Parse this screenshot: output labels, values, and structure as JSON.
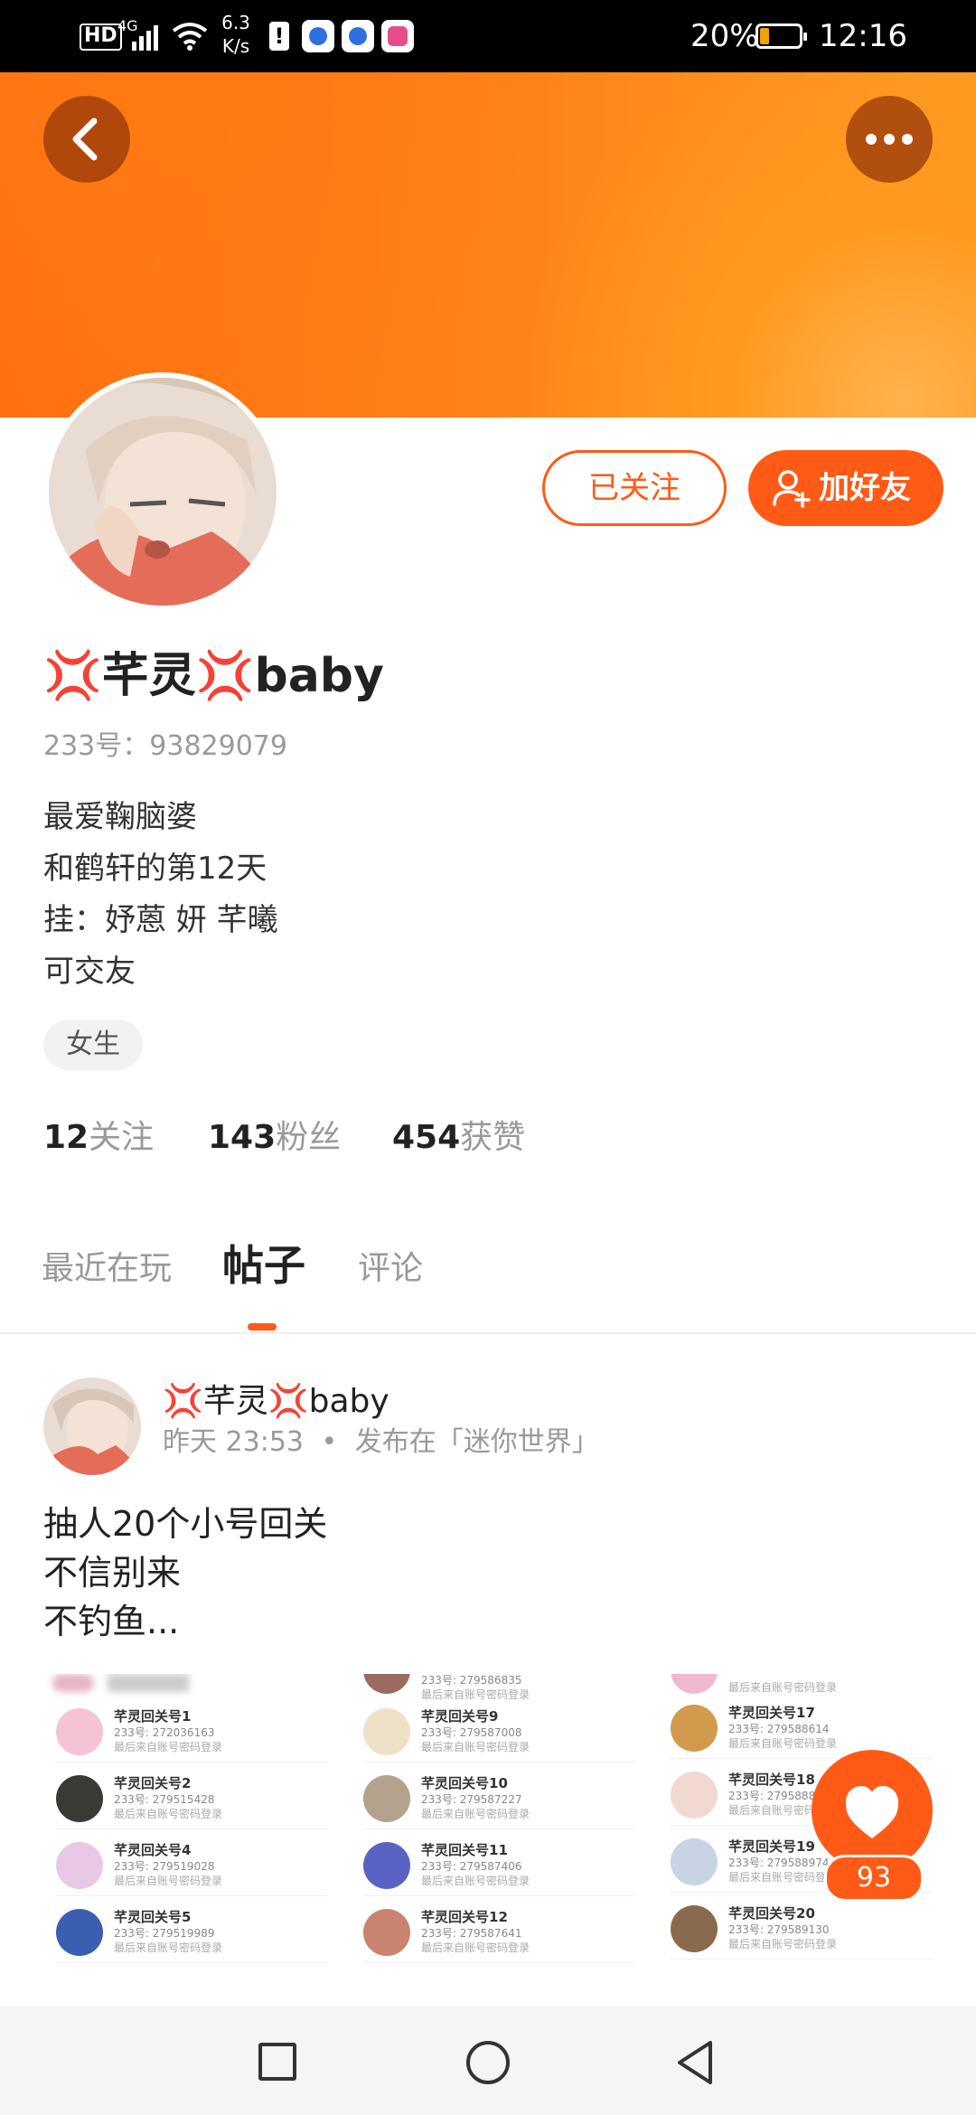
{
  "status_bar": {
    "hd": "HD",
    "network": "4G",
    "speed_value": "6.3",
    "speed_unit": "K/s",
    "battery": "20%",
    "time": "12:16"
  },
  "header": {
    "back_icon": "chevron-left-icon",
    "more_icon": "more-dots-icon"
  },
  "profile": {
    "name": "💢芊灵💢baby",
    "id_label": "233号：",
    "id_value": "93829079",
    "bio_lines": [
      "最爱鞠脑婆",
      "和鹤轩的第12天",
      "挂：妤蒽 妍 芊曦",
      "可交友"
    ],
    "gender_tag": "女生",
    "follow_button": "已关注",
    "add_friend_button": "加好友",
    "stats": [
      {
        "count": "12",
        "label": "关注"
      },
      {
        "count": "143",
        "label": "粉丝"
      },
      {
        "count": "454",
        "label": "获赞"
      }
    ]
  },
  "tabs": [
    {
      "label": "最近在玩",
      "active": false
    },
    {
      "label": "帖子",
      "active": true
    },
    {
      "label": "评论",
      "active": false
    }
  ],
  "post": {
    "author": "💢芊灵💢baby",
    "time": "昨天 23:53",
    "separator": "•",
    "posted_in": "发布在「迷你世界」",
    "lines": [
      "抽人20个小号回关",
      "不信别来",
      "不钓鱼..."
    ],
    "image_items": {
      "col1": [
        {
          "name": "芊灵回关号1",
          "id": "233号: 272036163",
          "note": "最后来自账号密码登录"
        },
        {
          "name": "芊灵回关号2",
          "id": "233号: 279515428",
          "note": "最后来自账号密码登录"
        },
        {
          "name": "芊灵回关号4",
          "id": "233号: 279519028",
          "note": "最后来自账号密码登录"
        },
        {
          "name": "芊灵回关号5",
          "id": "233号: 279519989",
          "note": "最后来自账号密码登录"
        }
      ],
      "col2": [
        {
          "name": "芊灵回关号9",
          "id": "233号: 279587008",
          "note": "最后来自账号密码登录"
        },
        {
          "name": "芊灵回关号10",
          "id": "233号: 279587227",
          "note": "最后来自账号密码登录"
        },
        {
          "name": "芊灵回关号11",
          "id": "233号: 279587406",
          "note": "最后来自账号密码登录"
        },
        {
          "name": "芊灵回关号12",
          "id": "233号: 279587641",
          "note": "最后来自账号密码登录"
        }
      ],
      "col3": [
        {
          "name": "芊灵回关号17",
          "id": "233号: 279588614",
          "note": "最后来自账号密码登录"
        },
        {
          "name": "芊灵回关号18",
          "id": "233号: 27958881",
          "note": "最后来自账号密码登录"
        },
        {
          "name": "芊灵回关号19",
          "id": "233号: 279588974",
          "note": "最后来自账号密码登录"
        },
        {
          "name": "芊灵回关号20",
          "id": "233号: 279589130",
          "note": "最后来自账号密码登录"
        }
      ],
      "top_partial": {
        "col2_id": "233号: 279586835",
        "note": "最后来自账号密码登录"
      }
    }
  },
  "like": {
    "count": "93",
    "icon": "heart-icon"
  },
  "colors": {
    "accent": "#ff5a16",
    "banner": "#ff7a13"
  }
}
